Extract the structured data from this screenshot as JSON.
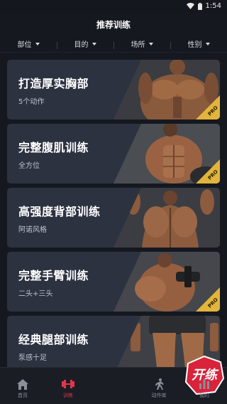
{
  "status_bar": {
    "time": "1:54"
  },
  "header": {
    "title": "推荐训练"
  },
  "filters": [
    {
      "label": "部位"
    },
    {
      "label": "目的"
    },
    {
      "label": "场所"
    },
    {
      "label": "性别"
    }
  ],
  "cards": [
    {
      "title": "打造厚实胸部",
      "subtitle": "5个动作",
      "pro": true,
      "badge": "PRO"
    },
    {
      "title": "完整腹肌训练",
      "subtitle": "全方位",
      "pro": true,
      "badge": "PRO"
    },
    {
      "title": "高强度背部训练",
      "subtitle": "阿诺风格",
      "pro": false,
      "badge": ""
    },
    {
      "title": "完整手臂训练",
      "subtitle": "二头+三头",
      "pro": true,
      "badge": "PRO"
    },
    {
      "title": "经典腿部训练",
      "subtitle": "泵感十足",
      "pro": false,
      "badge": ""
    }
  ],
  "tabbar": {
    "items": [
      {
        "label": "首页",
        "icon": "home-icon"
      },
      {
        "label": "训练",
        "icon": "dumbbell-icon",
        "active": true
      },
      {
        "label": "",
        "icon": "app-logo"
      },
      {
        "label": "动作库",
        "icon": "runner-icon"
      },
      {
        "label": "我的",
        "icon": "stats-icon"
      }
    ],
    "logo_text": "开练"
  },
  "colors": {
    "background": "#15181f",
    "card": "#2d3241",
    "accent": "#e0354a",
    "pro": "#e2b43c"
  }
}
